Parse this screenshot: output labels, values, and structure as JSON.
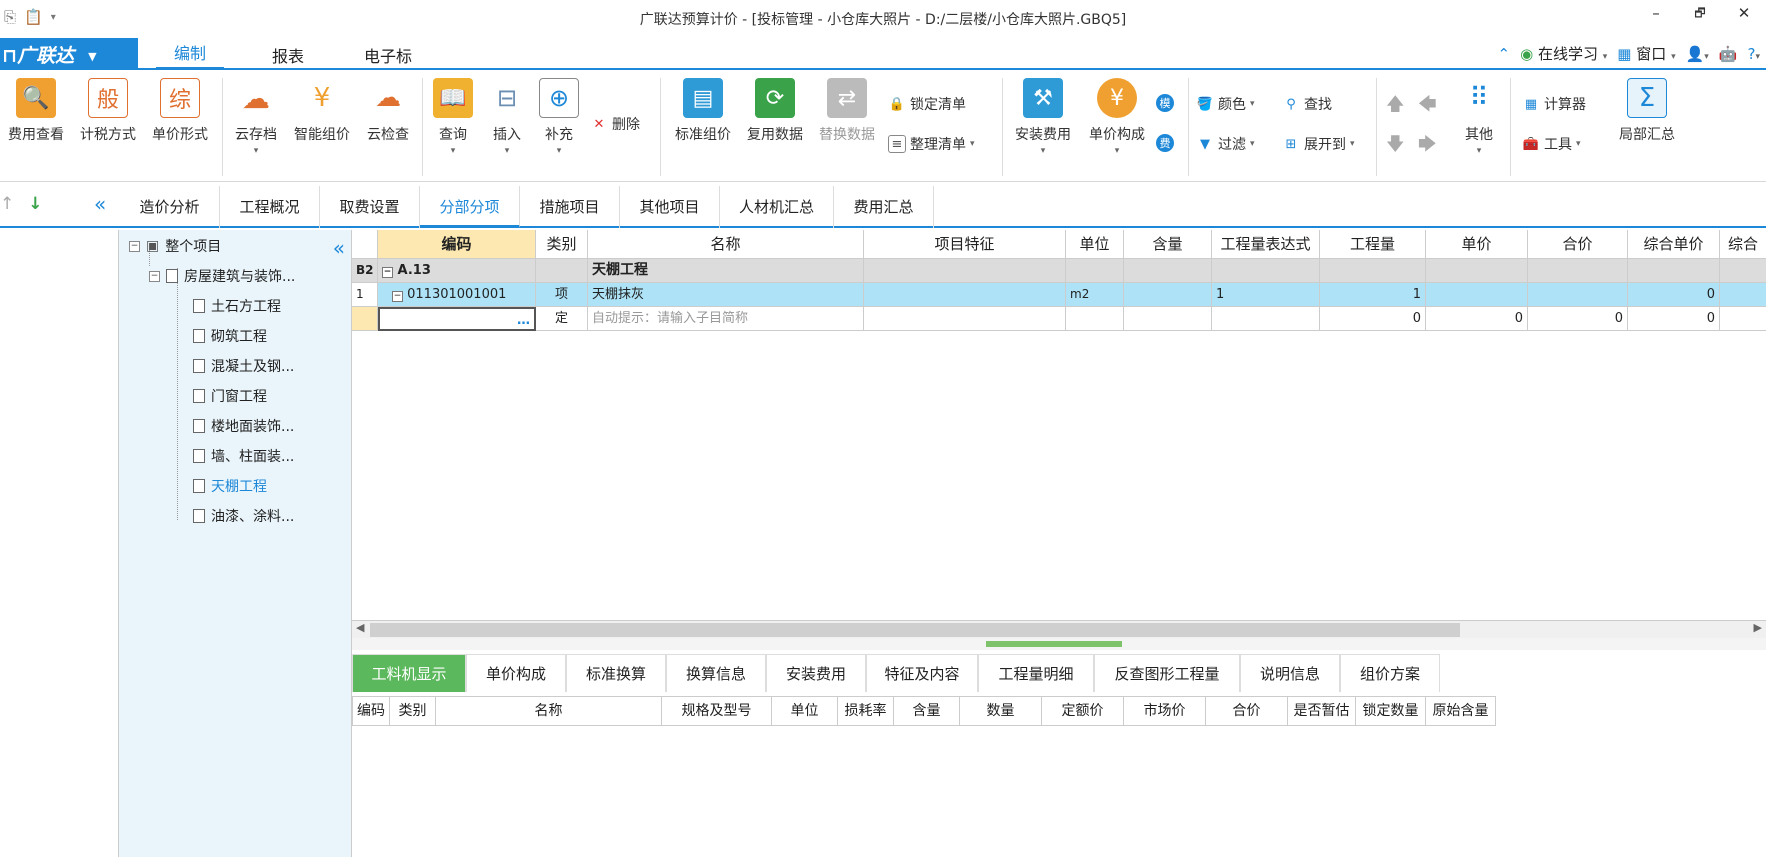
{
  "window": {
    "title": "广联达预算计价 - [投标管理 - 小仓库大照片 - D:/二层楼/小仓库大照片.GBQ5]",
    "qa_icons": [
      "copy-icon",
      "paste-icon",
      "customize-icon"
    ],
    "controls": {
      "minimize": "–",
      "restore": "🗗",
      "close": "✕"
    }
  },
  "menu": {
    "brand": "广联达",
    "tabs": [
      "编制",
      "报表",
      "电子标"
    ],
    "right": {
      "online": "在线学习",
      "window": "窗口",
      "help": "?"
    }
  },
  "ribbon": {
    "buttons": [
      {
        "label": "费用查看"
      },
      {
        "label": "计税方式"
      },
      {
        "label": "单价形式"
      },
      {
        "label": "云存档"
      },
      {
        "label": "智能组价"
      },
      {
        "label": "云检查"
      },
      {
        "label": "查询"
      },
      {
        "label": "插入"
      },
      {
        "label": "补充"
      },
      {
        "label": "标准组价"
      },
      {
        "label": "复用数据"
      },
      {
        "label": "替换数据"
      },
      {
        "label": "安装费用"
      },
      {
        "label": "单价构成"
      },
      {
        "label": "其他"
      },
      {
        "label": "局部汇总"
      }
    ],
    "small": {
      "delete": "删除",
      "lock_list": "锁定清单",
      "organize_list": "整理清单",
      "color": "颜色",
      "find": "查找",
      "filter": "过滤",
      "expand_to": "展开到",
      "calculator": "计算器",
      "tools": "工具",
      "badge_mo": "模",
      "badge_fei": "费"
    }
  },
  "tabs": [
    "造价分析",
    "工程概况",
    "取费设置",
    "分部分项",
    "措施项目",
    "其他项目",
    "人材机汇总",
    "费用汇总"
  ],
  "active_tab": "分部分项",
  "tree": {
    "root": "整个项目",
    "child": "房屋建筑与装饰...",
    "leaves": [
      "土石方工程",
      "砌筑工程",
      "混凝土及钢...",
      "门窗工程",
      "楼地面装饰...",
      "墙、柱面装...",
      "天棚工程",
      "油漆、涂料..."
    ],
    "selected": "天棚工程"
  },
  "grid": {
    "headers": [
      "",
      "编码",
      "类别",
      "名称",
      "项目特征",
      "单位",
      "含量",
      "工程量表达式",
      "工程量",
      "单价",
      "合价",
      "综合单价",
      "综合"
    ],
    "rows": [
      {
        "no": "B2",
        "code": "A.13",
        "type": "",
        "name": "天棚工程",
        "feature": "",
        "unit": "",
        "content": "",
        "expr": "",
        "qty": "",
        "price": "",
        "total": "",
        "uprice": ""
      },
      {
        "no": "1",
        "code": "011301001001",
        "type": "项",
        "name": "天棚抹灰",
        "feature": "",
        "unit": "m2",
        "content": "",
        "expr": "1",
        "qty": "1",
        "price": "",
        "total": "",
        "uprice": "0"
      },
      {
        "no": "",
        "code": "…",
        "type": "定",
        "name": "自动提示：请输入子目简称",
        "feature": "",
        "unit": "",
        "content": "",
        "expr": "",
        "qty": "0",
        "price": "0",
        "total": "0",
        "uprice": "0"
      }
    ]
  },
  "bottom": {
    "tabs": [
      "工料机显示",
      "单价构成",
      "标准换算",
      "换算信息",
      "安装费用",
      "特征及内容",
      "工程量明细",
      "反查图形工程量",
      "说明信息",
      "组价方案"
    ],
    "active": "工料机显示",
    "headers": [
      "编码",
      "类别",
      "名称",
      "规格及型号",
      "单位",
      "损耗率",
      "含量",
      "数量",
      "定额价",
      "市场价",
      "合价",
      "是否暂估",
      "锁定数量",
      "原始含量"
    ]
  },
  "colors": {
    "accent": "#1e88d8",
    "green_tab": "#5cb85c",
    "row_highlight": "#aee3f7",
    "group_row": "#dcdcdc",
    "code_header": "#fde8b2"
  }
}
